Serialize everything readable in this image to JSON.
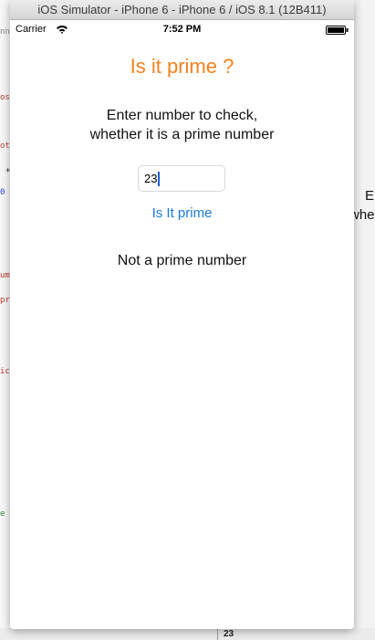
{
  "window": {
    "title": "iOS Simulator - iPhone 6 - iPhone 6 / iOS 8.1 (12B411)"
  },
  "status_bar": {
    "carrier": "Carrier",
    "time": "7:52 PM",
    "icons": [
      "wifi-icon",
      "battery-icon"
    ]
  },
  "app": {
    "title": "Is it prime ?",
    "instructions_line1": "Enter number to check,",
    "instructions_line2": "whether it is a prime number",
    "input_value": "23",
    "check_button_label": "Is It prime",
    "result": "Not a prime number"
  },
  "background": {
    "right_fragments": [
      "E",
      "whe"
    ],
    "bottom_cell": "23"
  },
  "colors": {
    "title_orange": "#f5821f",
    "ios_blue": "#1a7ad9",
    "caret_blue": "#1a5fd6"
  }
}
